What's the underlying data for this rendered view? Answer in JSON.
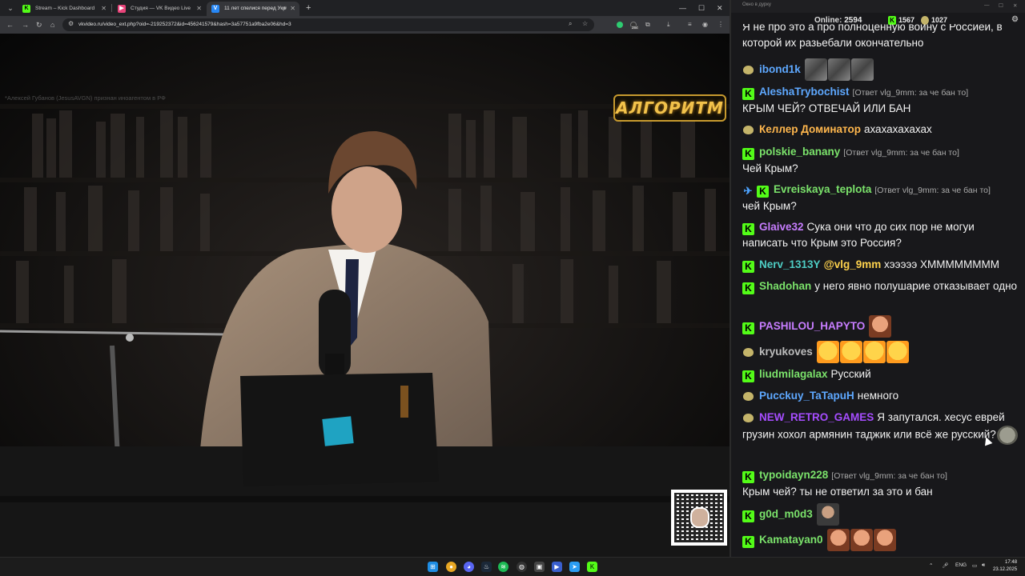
{
  "browser": {
    "tabs": [
      {
        "label": "Stream – Kick Dashboard",
        "icon": "kick-icon",
        "color": "#53fc18",
        "active": false
      },
      {
        "label": "Студия — VK Видео Live",
        "icon": "vk-video-icon",
        "color": "#e8447a",
        "active": false
      },
      {
        "label": "11 лет спелися перед Укр",
        "icon": "vk-icon",
        "color": "#2787f5",
        "active": true
      }
    ],
    "new_tab_symbol": "+",
    "window_controls": {
      "minimize": "—",
      "maximize": "☐",
      "close": "✕"
    },
    "address": {
      "url": "vkvideo.ru/video_ext.php?oid=-219252372&id=456241579&hash=3a57751a9fba2e06&hd=3"
    },
    "extension_badge": "284"
  },
  "video": {
    "disclaimer": "*Алексей Губанов (JesusAVGN) признан иноагентом в РФ",
    "logo": "АЛГОРИТМ"
  },
  "chat": {
    "window_title": "Окно в дурку",
    "online_label": "Online:",
    "online_count": "2594",
    "kick_count": "1567",
    "vk_count": "1027",
    "messages": [
      {
        "src": "none",
        "user": "",
        "user_color": "#f2f2f2",
        "reply": "",
        "text": "Я не про это а про полноценную войну с Россией, в которой их разьебали окончательно",
        "emotes": []
      },
      {
        "src": "vk",
        "user": "ibond1k",
        "user_color": "#5ea8ff",
        "reply": "",
        "text": "",
        "emotes": [
          "gray",
          "gray",
          "gray"
        ]
      },
      {
        "src": "kick",
        "user": "AleshaTrybochist",
        "user_color": "#5ea8ff",
        "reply": "[Ответ vlg_9mm: за че бан то]",
        "text": "КРЫМ ЧЕЙ? ОТВЕЧАЙ ИЛИ БАН",
        "emotes": []
      },
      {
        "src": "vk",
        "user": "Келлер Доминатор",
        "user_color": "#ffb74d",
        "reply": "",
        "text": "ахахахахахах",
        "emotes": []
      },
      {
        "src": "kick",
        "user": "polskie_banany",
        "user_color": "#7be36b",
        "reply": "[Ответ vlg_9mm: за че бан то]",
        "text": "Чей Крым?",
        "emotes": []
      },
      {
        "src": "kick",
        "user": "Evreiskaya_teplota",
        "user_color": "#7be36b",
        "reply": "[Ответ vlg_9mm: за че бан то]",
        "text": "чей Крым?",
        "emotes": [],
        "pin": true
      },
      {
        "src": "kick",
        "user": "Glaive32",
        "user_color": "#c77dff",
        "reply": "",
        "text": "Сука они что до сих пор не могуи написать что Крым это Россия?",
        "emotes": []
      },
      {
        "src": "kick",
        "user": "Nerv_1313Y",
        "user_color": "#4ecdc4",
        "reply": "",
        "mention": "@vlg_9mm",
        "text": "хэээээ ХММММММММ",
        "emotes": []
      },
      {
        "src": "kick",
        "user": "Shadohan",
        "user_color": "#7be36b",
        "reply": "",
        "text": "у него явно полушарие отказывает одно",
        "emotes": []
      },
      {
        "src": "kick",
        "user": "PASHILOU_HAPYTO",
        "user_color": "#c77dff",
        "reply": "",
        "text": "",
        "emotes": [
          "face"
        ]
      },
      {
        "src": "vk",
        "user": "kryukoves",
        "user_color": "#bdbdbd",
        "reply": "",
        "text": "",
        "emotes": [
          "laugh",
          "laugh",
          "laugh",
          "laugh"
        ]
      },
      {
        "src": "kick",
        "user": "liudmilagalax",
        "user_color": "#7be36b",
        "reply": "",
        "text": "Русский",
        "emotes": []
      },
      {
        "src": "vk",
        "user": "Pucckuy_TaTapuH",
        "user_color": "#5ea8ff",
        "reply": "",
        "text": "немного",
        "emotes": []
      },
      {
        "src": "vk",
        "user": "NEW_RETRO_GAMES",
        "user_color": "#a64dff",
        "reply": "",
        "text": "Я запутался. хесус еврей грузин хохол армянин таджик или всё же русский?",
        "emotes": [
          "rock"
        ]
      },
      {
        "src": "kick",
        "user": "typoidayn228",
        "user_color": "#7be36b",
        "reply": "[Ответ vlg_9mm: за че бан то]",
        "text": "Крым чей? ты не ответил за это и бан",
        "emotes": []
      },
      {
        "src": "kick",
        "user": "g0d_m0d3",
        "user_color": "#7be36b",
        "reply": "",
        "text": "",
        "emotes": [
          "man"
        ]
      },
      {
        "src": "kick",
        "user": "Kamatayan0",
        "user_color": "#7be36b",
        "reply": "",
        "text": "",
        "emotes": [
          "face",
          "face",
          "face"
        ]
      }
    ]
  },
  "taskbar": {
    "language": "ENG",
    "time": "17:48",
    "date": "23.12.2025"
  }
}
